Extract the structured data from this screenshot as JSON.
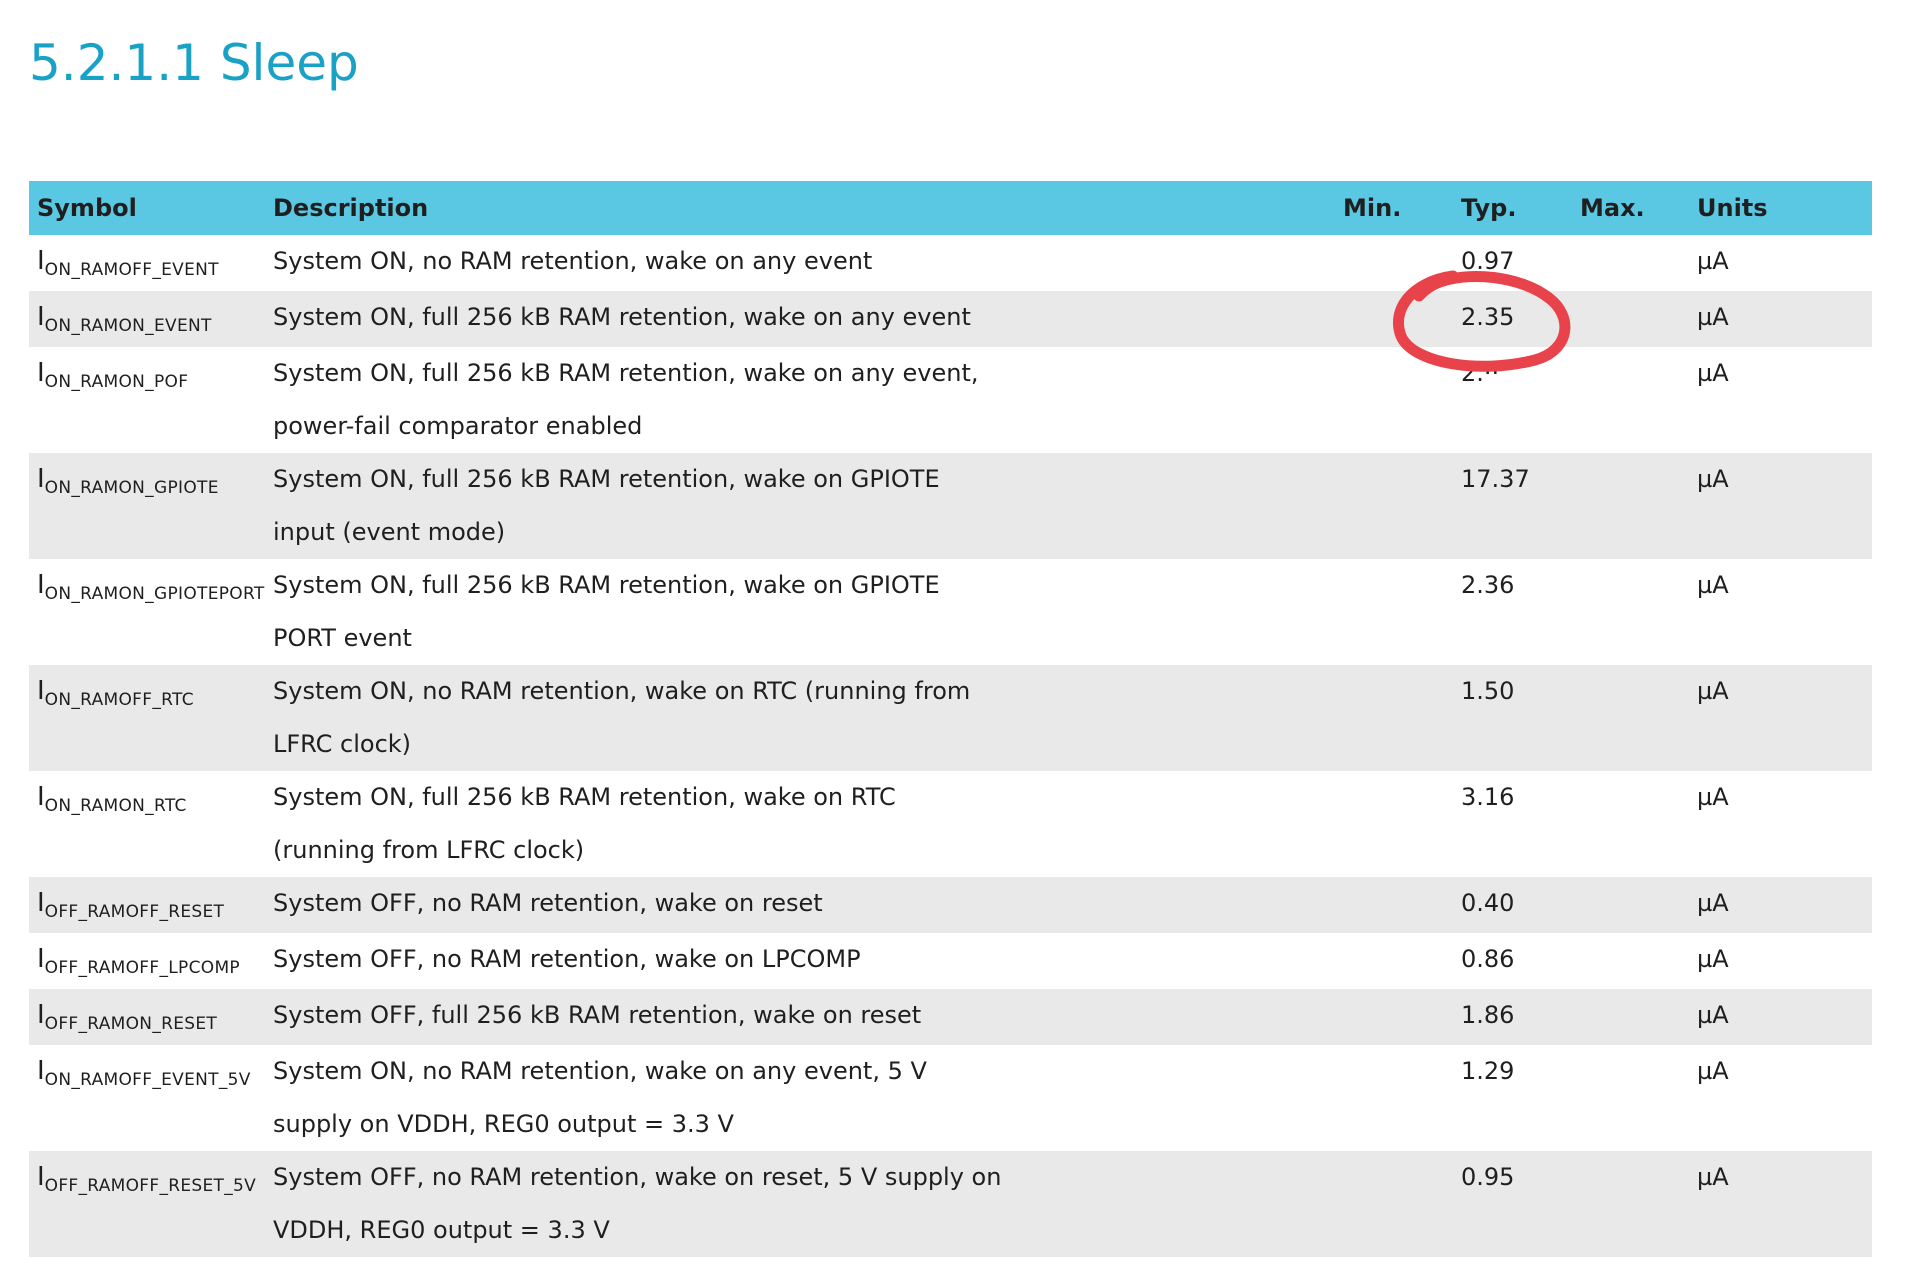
{
  "section": {
    "title": "5.2.1.1 Sleep"
  },
  "table": {
    "headers": {
      "symbol": "Symbol",
      "description": "Description",
      "min": "Min.",
      "typ": "Typ.",
      "max": "Max.",
      "units": "Units"
    },
    "rows": [
      {
        "symbol_base": "I",
        "symbol_sub": "ON_RAMOFF_EVENT",
        "desc1": "System ON, no RAM retention, wake on any event",
        "desc2": "",
        "min": "",
        "typ": "0.97",
        "max": "",
        "units": "µA"
      },
      {
        "symbol_base": "I",
        "symbol_sub": "ON_RAMON_EVENT",
        "desc1": "System ON, full 256 kB RAM retention, wake on any event",
        "desc2": "",
        "min": "",
        "typ": "2.35",
        "max": "",
        "units": "µA"
      },
      {
        "symbol_base": "I",
        "symbol_sub": "ON_RAMON_POF",
        "desc1": "System ON, full 256 kB RAM retention, wake on any event,",
        "desc2": "power-fail comparator enabled",
        "min": "",
        "typ": "2.··",
        "max": "",
        "units": "µA"
      },
      {
        "symbol_base": "I",
        "symbol_sub": "ON_RAMON_GPIOTE",
        "desc1": "System ON, full 256 kB RAM retention, wake on GPIOTE",
        "desc2": "input (event mode)",
        "min": "",
        "typ": "17.37",
        "max": "",
        "units": "µA"
      },
      {
        "symbol_base": "I",
        "symbol_sub": "ON_RAMON_GPIOTEPORT",
        "desc1": "System ON, full 256 kB RAM retention, wake on GPIOTE",
        "desc2": "PORT event",
        "min": "",
        "typ": "2.36",
        "max": "",
        "units": "µA"
      },
      {
        "symbol_base": "I",
        "symbol_sub": "ON_RAMOFF_RTC",
        "desc1": "System ON, no RAM retention, wake on RTC (running from",
        "desc2": "LFRC clock)",
        "min": "",
        "typ": "1.50",
        "max": "",
        "units": "µA"
      },
      {
        "symbol_base": "I",
        "symbol_sub": "ON_RAMON_RTC",
        "desc1": "System ON, full 256 kB RAM retention, wake on RTC",
        "desc2": "(running from LFRC clock)",
        "min": "",
        "typ": "3.16",
        "max": "",
        "units": "µA"
      },
      {
        "symbol_base": "I",
        "symbol_sub": "OFF_RAMOFF_RESET",
        "desc1": "System OFF, no RAM retention, wake on reset",
        "desc2": "",
        "min": "",
        "typ": "0.40",
        "max": "",
        "units": "µA"
      },
      {
        "symbol_base": "I",
        "symbol_sub": "OFF_RAMOFF_LPCOMP",
        "desc1": "System OFF, no RAM retention, wake on LPCOMP",
        "desc2": "",
        "min": "",
        "typ": "0.86",
        "max": "",
        "units": "µA"
      },
      {
        "symbol_base": "I",
        "symbol_sub": "OFF_RAMON_RESET",
        "desc1": "System OFF, full 256 kB RAM retention, wake on reset",
        "desc2": "",
        "min": "",
        "typ": "1.86",
        "max": "",
        "units": "µA"
      },
      {
        "symbol_base": "I",
        "symbol_sub": "ON_RAMOFF_EVENT_5V",
        "desc1": "System ON, no RAM retention, wake on any event, 5 V",
        "desc2": "supply on VDDH, REG0 output = 3.3 V",
        "min": "",
        "typ": "1.29",
        "max": "",
        "units": "µA"
      },
      {
        "symbol_base": "I",
        "symbol_sub": "OFF_RAMOFF_RESET_5V",
        "desc1": "System OFF, no RAM retention, wake on reset, 5 V supply on",
        "desc2": "VDDH, REG0 output = 3.3 V",
        "min": "",
        "typ": "0.95",
        "max": "",
        "units": "µA"
      }
    ]
  },
  "annotation": {
    "shape": "hand-drawn circle",
    "color": "#e8424a",
    "target": "2.35"
  }
}
